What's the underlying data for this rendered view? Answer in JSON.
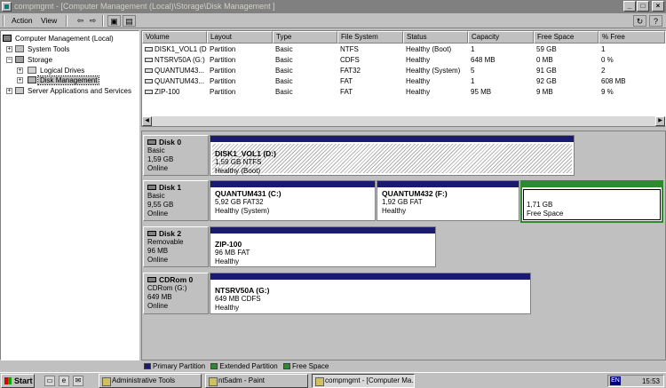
{
  "window": {
    "title": "compmgmt - [Computer Management (Local)\\Storage\\Disk Management ]"
  },
  "menubar": {
    "action": "Action",
    "view": "View"
  },
  "tree": [
    {
      "label": "Computer Management (Local)",
      "icon": "computer-icon"
    },
    {
      "label": "System Tools",
      "icon": "tools-icon"
    },
    {
      "label": "Storage",
      "icon": "storage-icon"
    },
    {
      "label": "Logical Drives",
      "icon": "drive-icon"
    },
    {
      "label": "Disk Management",
      "icon": "disk-icon"
    },
    {
      "label": "Server Applications and Services",
      "icon": "server-icon"
    }
  ],
  "volumes": {
    "columns": [
      "Volume",
      "Layout",
      "Type",
      "File System",
      "Status",
      "Capacity",
      "Free Space",
      "% Free"
    ],
    "rows": [
      [
        "DISK1_VOL1 (D:)",
        "Partition",
        "Basic",
        "NTFS",
        "Healthy (Boot)",
        "1",
        "59 GB",
        "1"
      ],
      [
        "NTSRV50A (G:)",
        "Partition",
        "Basic",
        "CDFS",
        "Healthy",
        "648 MB",
        "0 MB",
        "0 %"
      ],
      [
        "QUANTUM43...",
        "Partition",
        "Basic",
        "FAT32",
        "Healthy (System)",
        "5",
        "91 GB",
        "2"
      ],
      [
        "QUANTUM43...",
        "Partition",
        "Basic",
        "FAT",
        "Healthy",
        "1",
        "92 GB",
        "608 MB"
      ],
      [
        "ZIP-100",
        "Partition",
        "Basic",
        "FAT",
        "Healthy",
        "95 MB",
        "9 MB",
        "9 %"
      ]
    ]
  },
  "disks": [
    {
      "name": "Disk 0",
      "kind": "Basic",
      "size": "1,59 GB",
      "status": "Online",
      "partitions": [
        {
          "name": "DISK1_VOL1  (D:)",
          "info": "1,59 GB NTFS",
          "status": "Healthy (Boot)"
        }
      ]
    },
    {
      "name": "Disk 1",
      "kind": "Basic",
      "size": "9,55 GB",
      "status": "Online",
      "partitions": [
        {
          "name": "QUANTUM431  (C:)",
          "info": "5,92 GB FAT32",
          "status": "Healthy (System)"
        },
        {
          "name": "QUANTUM432  (F:)",
          "info": "1,92 GB FAT",
          "status": "Healthy"
        },
        {
          "name": "",
          "info": "1,71 GB",
          "status": "Free Space"
        }
      ]
    },
    {
      "name": "Disk 2",
      "kind": "Removable",
      "size": "96 MB",
      "status": "Online",
      "partitions": [
        {
          "name": "ZIP-100",
          "info": "96 MB FAT",
          "status": "Healthy"
        }
      ]
    },
    {
      "name": "CDRom 0",
      "kind": "CDRom (G:)",
      "size": "649 MB",
      "status": "Online",
      "partitions": [
        {
          "name": "NTSRV50A  (G:)",
          "info": "649 MB CDFS",
          "status": "Healthy"
        }
      ]
    }
  ],
  "legend": {
    "primary": "Primary Partition",
    "extended": "Extended Partition",
    "free": "Free Space",
    "colors": {
      "primary": "#1a1a6e",
      "extended": "#2d8a2d",
      "free": "#2d8a2d"
    }
  },
  "taskbar": {
    "start": "Start",
    "tasks": [
      "Administrative Tools",
      "nt5adm - Paint",
      "compmgmt - [Computer Ma..."
    ],
    "lang": "EN",
    "clock": "15:53"
  }
}
